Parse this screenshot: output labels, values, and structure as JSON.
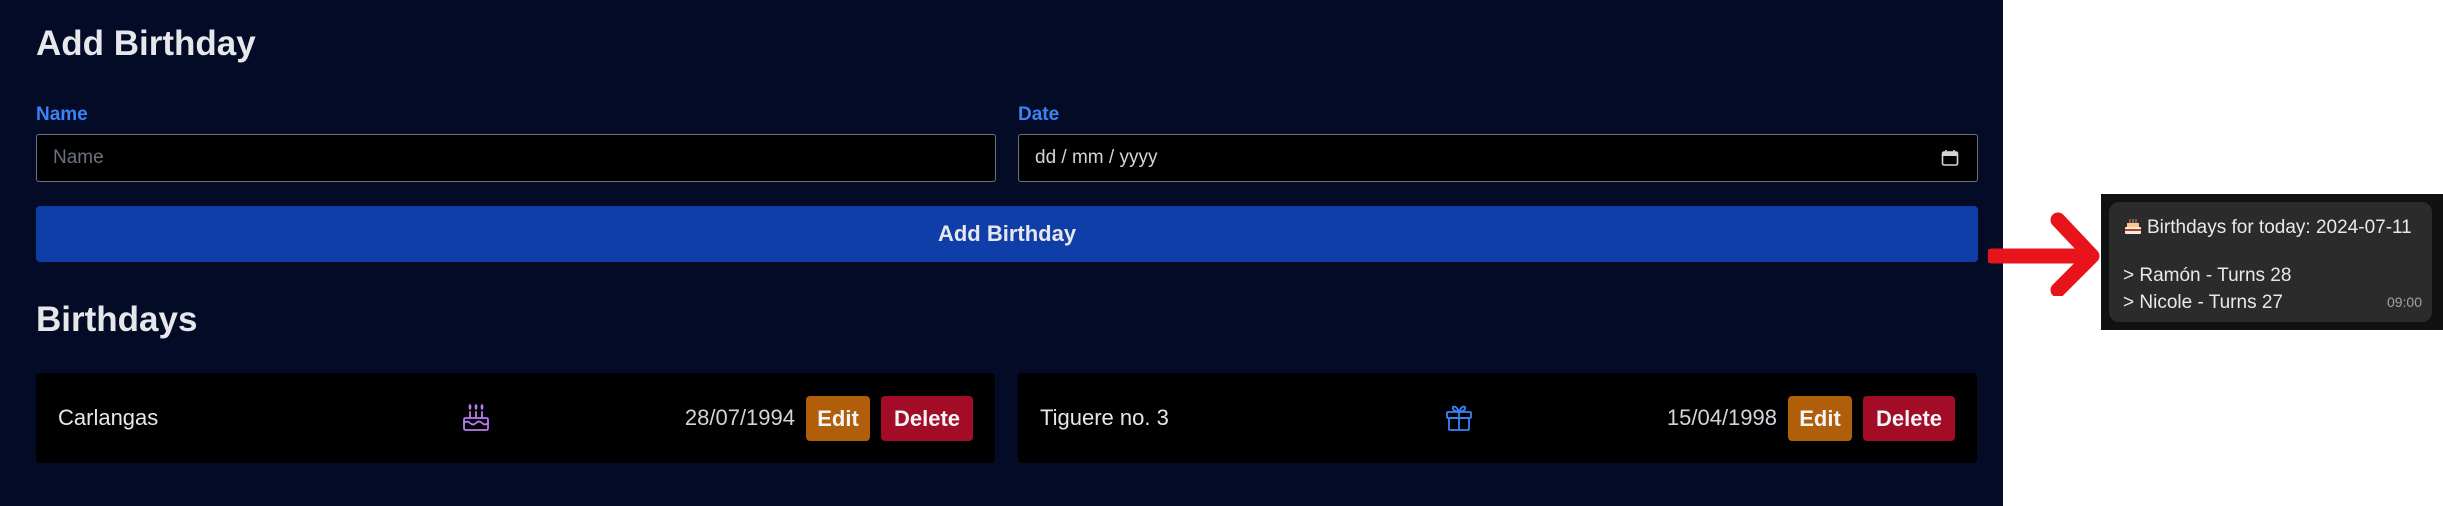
{
  "form": {
    "title": "Add Birthday",
    "name_label": "Name",
    "name_placeholder": "Name",
    "date_label": "Date",
    "date_placeholder": "dd / mm / yyyy",
    "submit_label": "Add Birthday"
  },
  "list": {
    "title": "Birthdays",
    "items": [
      {
        "name": "Carlangas",
        "icon": "birthday-cake-icon",
        "date": "28/07/1994",
        "edit_label": "Edit",
        "delete_label": "Delete"
      },
      {
        "name": "Tiguere no. 3",
        "icon": "gift-icon",
        "date": "15/04/1998",
        "edit_label": "Edit",
        "delete_label": "Delete"
      }
    ]
  },
  "notification": {
    "icon": "birthday-cake-icon",
    "title": "Birthdays for today: 2024-07-11",
    "lines": [
      "> Ramón - Turns 28",
      "> Nicole - Turns 27"
    ],
    "time": "09:00"
  },
  "colors": {
    "app_background": "#030b26",
    "accent_blue": "#0f3ea9",
    "label_blue": "#3b82f6",
    "edit_orange": "#b15e0a",
    "delete_red": "#a20c26",
    "arrow_red": "#e8131b"
  }
}
